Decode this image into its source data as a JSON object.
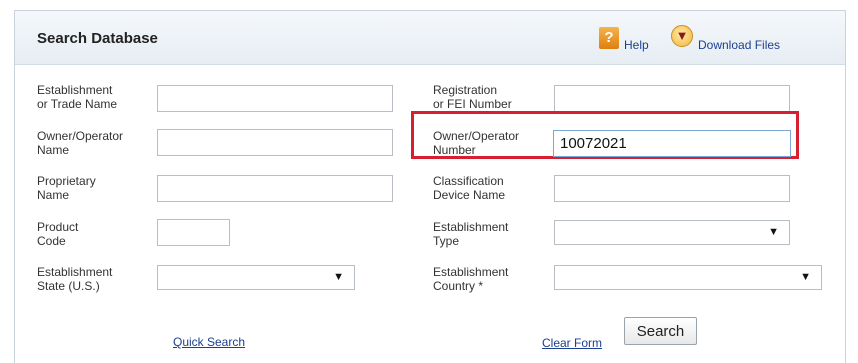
{
  "header": {
    "title": "Search Database",
    "help_label": "Help",
    "download_label": "Download Files",
    "icons": {
      "help": "help-icon",
      "download": "download-icon"
    }
  },
  "form": {
    "left": [
      {
        "label1": "Establishment",
        "label2": "or Trade Name",
        "type": "text",
        "value": ""
      },
      {
        "label1": "Owner/Operator",
        "label2": "Name",
        "type": "text",
        "value": ""
      },
      {
        "label1": "Proprietary",
        "label2": "Name",
        "type": "text",
        "value": ""
      },
      {
        "label1": "Product",
        "label2": "Code",
        "type": "text",
        "value": ""
      },
      {
        "label1": "Establishment",
        "label2": "State (U.S.)",
        "type": "select",
        "value": ""
      }
    ],
    "right": [
      {
        "label1": "Registration",
        "label2": "or FEI Number",
        "type": "text",
        "value": ""
      },
      {
        "label1": "Owner/Operator",
        "label2": "Number",
        "type": "text",
        "value": "10072021"
      },
      {
        "label1": "Classification",
        "label2": "Device Name",
        "type": "text",
        "value": ""
      },
      {
        "label1": "Establishment",
        "label2": "Type",
        "type": "select",
        "value": ""
      },
      {
        "label1": "Establishment",
        "label2": "Country *",
        "type": "select",
        "value": ""
      }
    ]
  },
  "footer": {
    "quick_search_label": "Quick Search",
    "clear_form_label": "Clear Form",
    "search_button_label": "Search"
  },
  "colors": {
    "highlight_border": "#d62030",
    "link": "#1c3f8f",
    "header_bg": "#e6edf3"
  }
}
